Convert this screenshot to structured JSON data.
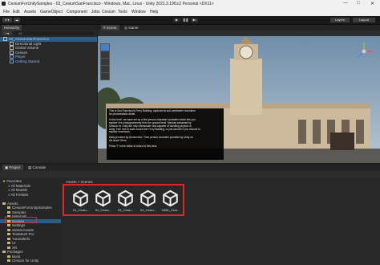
{
  "window": {
    "title": "CesiumForUnitySamples - 03_CesiumSanFrancisco - Windows, Mac, Linux - Unity 2021.3.19f1c2 Personal <DX11>",
    "controls": [
      "—",
      "□",
      "✕"
    ]
  },
  "menu": [
    "File",
    "Edit",
    "Assets",
    "GameObject",
    "Component",
    "Jobs",
    "Cesium",
    "Tools",
    "Window",
    "Help"
  ],
  "toolbar": {
    "account": "♦ ▾",
    "cloud": "☁",
    "play": "▶",
    "pause": "❚❚",
    "step": "▶|",
    "layers": "Layers",
    "layout": "Layout"
  },
  "hierarchy": {
    "tab": "Hierarchy",
    "search_placeholder": "All",
    "items": [
      {
        "label": "03_CesiumSanFrancisco",
        "depth": 0,
        "selected": true
      },
      {
        "label": "Directional Light",
        "depth": 1
      },
      {
        "label": "Global Volume",
        "depth": 1
      },
      {
        "label": "Cesium",
        "depth": 1
      },
      {
        "label": "Player",
        "depth": 1
      },
      {
        "label": "Getting Started",
        "depth": 1
      }
    ]
  },
  "scene_view": {
    "tabs": [
      "Scene",
      "Game"
    ],
    "info_text": [
      "This is San Francisco's Ferry Building, captured at sub-centimeter resolution",
      "for photorealistic detail.",
      "",
      "In this level, we have set up a first-person character controller which lets you",
      "explore this photogrammetry from the ground level. Meshes streamed by",
      "Cesium for Unity are fully interactable and capable of handling physics in",
      "Unity. Feel free to walk around the Ferry Building, or just wonder if you choose to",
      "explore downtown.",
      "",
      "Data provided by Aerometrex. Third person controller provided by Unity on",
      "the Asset Store.",
      "",
      "Press \"I\" in the editor to return to this view."
    ]
  },
  "project": {
    "tabs": [
      "Project",
      "Console"
    ],
    "breadcrumb": "Assets > Scenes",
    "tree": [
      {
        "label": "Favorites",
        "depth": 0,
        "type": "star"
      },
      {
        "label": "All Materials",
        "depth": 1,
        "type": "search"
      },
      {
        "label": "All Models",
        "depth": 1,
        "type": "search"
      },
      {
        "label": "All Prefabs",
        "depth": 1,
        "type": "search"
      },
      {
        "label": "",
        "depth": 0,
        "type": "gap"
      },
      {
        "label": "Assets",
        "depth": 0,
        "type": "folder"
      },
      {
        "label": "CesiumForUnitySamples",
        "depth": 1,
        "type": "folder"
      },
      {
        "label": "Samples",
        "depth": 1,
        "type": "folder"
      },
      {
        "label": "Materials",
        "depth": 1,
        "type": "folder"
      },
      {
        "label": "Scenes",
        "depth": 1,
        "type": "folder",
        "selected": true
      },
      {
        "label": "Settings",
        "depth": 1,
        "type": "folder"
      },
      {
        "label": "StarterAssets",
        "depth": 1,
        "type": "folder"
      },
      {
        "label": "TextMesh Pro",
        "depth": 1,
        "type": "folder"
      },
      {
        "label": "TutorialInfo",
        "depth": 1,
        "type": "folder"
      },
      {
        "label": "UI",
        "depth": 1,
        "type": "folder"
      },
      {
        "label": "XR",
        "depth": 1,
        "type": "folder"
      },
      {
        "label": "Packages",
        "depth": 0,
        "type": "folder"
      },
      {
        "label": "Burst",
        "depth": 1,
        "type": "folder"
      },
      {
        "label": "Cesium for Unity",
        "depth": 1,
        "type": "folder"
      }
    ],
    "scenes": [
      {
        "label": "01_Cesiu..."
      },
      {
        "label": "02_Cesiu..."
      },
      {
        "label": "03_Cesiu..."
      },
      {
        "label": "04_Cesiu..."
      },
      {
        "label": "V881_Cesi..."
      }
    ]
  },
  "colors": {
    "highlight_box": "#e0262a",
    "selection": "#2c5d87",
    "accent_blue": "#4a9ce0"
  }
}
